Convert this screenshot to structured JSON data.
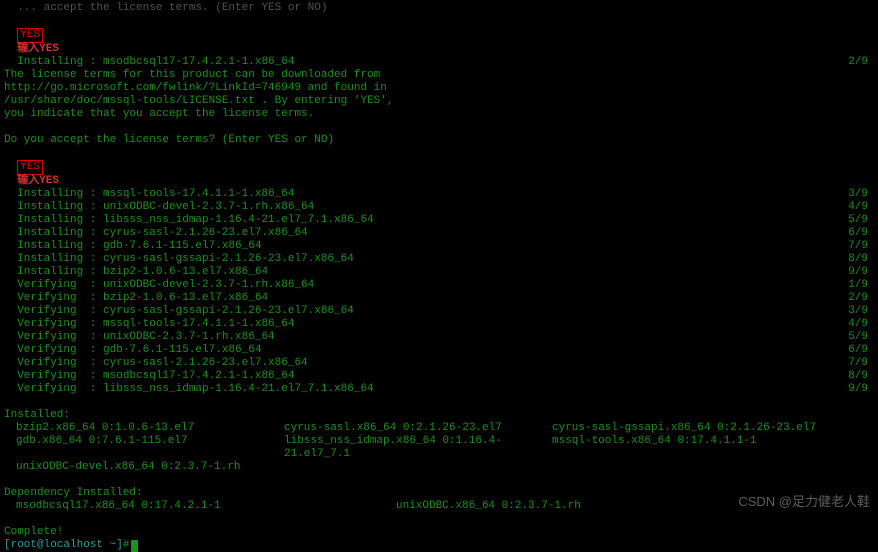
{
  "topDim": "  ... accept the license terms. (Enter YES or NO)",
  "yes": "YES",
  "enterYes": "输入YES",
  "installingTop": {
    "label": "  Installing : msodbcsql17-17.4.2.1-1.x86_64",
    "count": "2/9"
  },
  "licenseMsg": [
    "The license terms for this product can be downloaded from",
    "http://go.microsoft.com/fwlink/?LinkId=746949 and found in",
    "/usr/share/doc/mssql-tools/LICENSE.txt . By entering 'YES',",
    "you indicate that you accept the license terms."
  ],
  "question": "Do you accept the license terms? (Enter YES or NO)",
  "pkg": [
    {
      "a": "Installing",
      "p": "mssql-tools-17.4.1.1-1.x86_64",
      "c": "3/9"
    },
    {
      "a": "Installing",
      "p": "unixODBC-devel-2.3.7-1.rh.x86_64",
      "c": "4/9"
    },
    {
      "a": "Installing",
      "p": "libsss_nss_idmap-1.16.4-21.el7_7.1.x86_64",
      "c": "5/9"
    },
    {
      "a": "Installing",
      "p": "cyrus-sasl-2.1.26-23.el7.x86_64",
      "c": "6/9"
    },
    {
      "a": "Installing",
      "p": "gdb-7.6.1-115.el7.x86_64",
      "c": "7/9"
    },
    {
      "a": "Installing",
      "p": "cyrus-sasl-gssapi-2.1.26-23.el7.x86_64",
      "c": "8/9"
    },
    {
      "a": "Installing",
      "p": "bzip2-1.0.6-13.el7.x86_64",
      "c": "9/9"
    },
    {
      "a": "Verifying ",
      "p": "unixODBC-devel-2.3.7-1.rh.x86_64",
      "c": "1/9"
    },
    {
      "a": "Verifying ",
      "p": "bzip2-1.0.6-13.el7.x86_64",
      "c": "2/9"
    },
    {
      "a": "Verifying ",
      "p": "cyrus-sasl-gssapi-2.1.26-23.el7.x86_64",
      "c": "3/9"
    },
    {
      "a": "Verifying ",
      "p": "mssql-tools-17.4.1.1-1.x86_64",
      "c": "4/9"
    },
    {
      "a": "Verifying ",
      "p": "unixODBC-2.3.7-1.rh.x86_64",
      "c": "5/9"
    },
    {
      "a": "Verifying ",
      "p": "gdb-7.6.1-115.el7.x86_64",
      "c": "6/9"
    },
    {
      "a": "Verifying ",
      "p": "cyrus-sasl-2.1.26-23.el7.x86_64",
      "c": "7/9"
    },
    {
      "a": "Verifying ",
      "p": "msodbcsql17-17.4.2.1-1.x86_64",
      "c": "8/9"
    },
    {
      "a": "Verifying ",
      "p": "libsss_nss_idmap-1.16.4-21.el7_7.1.x86_64",
      "c": "9/9"
    }
  ],
  "installedHdr": "Installed:",
  "installedRow1": {
    "c0": "bzip2.x86_64 0:1.0.6-13.el7",
    "c1": "cyrus-sasl.x86_64 0:2.1.26-23.el7",
    "c2": "cyrus-sasl-gssapi.x86_64 0:2.1.26-23.el7"
  },
  "installedRow2": {
    "c0": "gdb.x86_64 0:7.6.1-115.el7",
    "c1": "libsss_nss_idmap.x86_64 0:1.16.4-21.el7_7.1",
    "c2": "mssql-tools.x86_64 0:17.4.1.1-1"
  },
  "installedRow3": {
    "c0": "unixODBC-devel.x86_64 0:2.3.7-1.rh",
    "c1": "",
    "c2": ""
  },
  "depHdr": "Dependency Installed:",
  "depRow": {
    "c0": "msodbcsql17.x86_64 0:17.4.2.1-1",
    "c1": "unixODBC.x86_64 0:2.3.7-1.rh"
  },
  "complete": "Complete!",
  "prompt": {
    "userhost": "[root@localhost ~]",
    "hash": "# "
  },
  "watermark": "CSDN @足力健老人鞋"
}
